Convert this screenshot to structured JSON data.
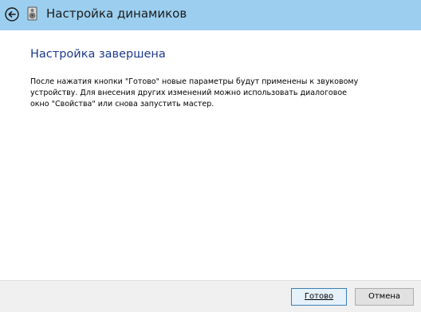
{
  "window": {
    "title": "Настройка динамиков"
  },
  "content": {
    "heading": "Настройка завершена",
    "body": "После нажатия кнопки \"Готово\" новые параметры будут применены к звуковому устройству.  Для внесения других изменений можно использовать диалоговое окно \"Свойства\" или снова запустить мастер."
  },
  "buttons": {
    "finish_label": "Готово",
    "cancel_label": "Отмена"
  },
  "icons": {
    "back": "back-arrow-icon",
    "app": "speaker-icon"
  },
  "colors": {
    "titlebar": "#9ccfef",
    "heading": "#1c3a8a",
    "footer": "#f0f0f0"
  }
}
